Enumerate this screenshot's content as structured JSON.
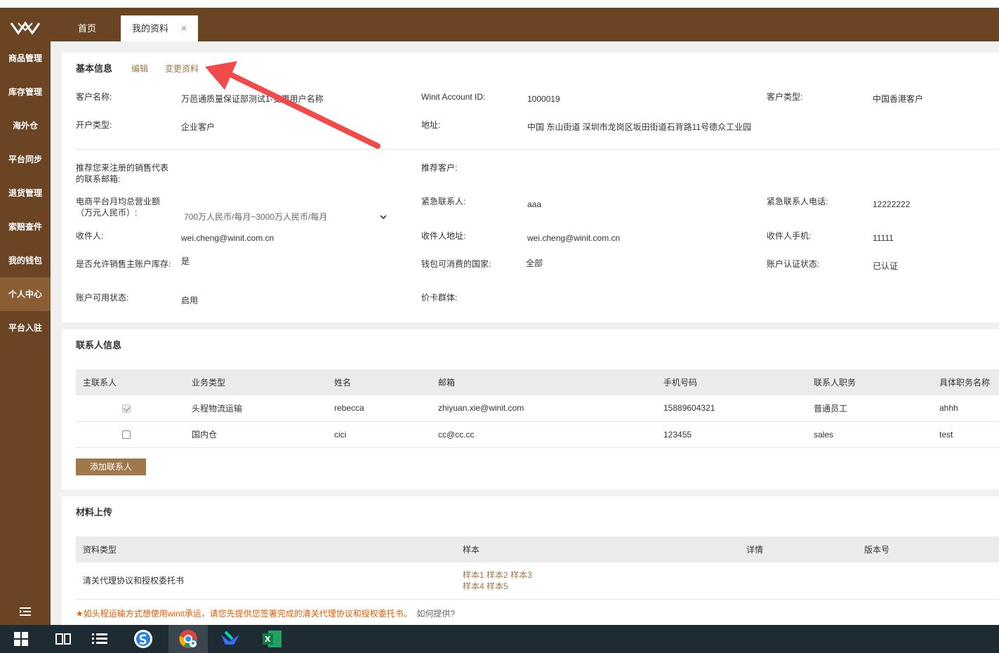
{
  "sidebar": {
    "items": [
      {
        "label": "商品管理"
      },
      {
        "label": "库存管理"
      },
      {
        "label": "海外仓"
      },
      {
        "label": "平台同步"
      },
      {
        "label": "退货管理"
      },
      {
        "label": "索赔查件"
      },
      {
        "label": "我的钱包"
      },
      {
        "label": "个人中心"
      },
      {
        "label": "平台入驻"
      }
    ],
    "active_index": 7
  },
  "tabs": {
    "home": "首页",
    "profile": "我的资料",
    "close": "×"
  },
  "basic": {
    "title": "基本信息",
    "edit": "编辑",
    "change": "变更资料",
    "customer_name_label": "客户名称:",
    "customer_name_value": "万邑通质量保证部测试1-变更用户名称",
    "account_id_label": "Winit Account ID:",
    "account_id_value": "1000019",
    "customer_type_label": "客户类型:",
    "customer_type_value": "中国香港客户",
    "open_type_label": "开户类型:",
    "open_type_value": "企业客户",
    "address_label": "地址:",
    "address_value": "中国 东山街道 深圳市龙岗区坂田街道石背路11号德众工业园",
    "rep_email_label": "推荐您来注册的销售代表的联系邮箱:",
    "rep_email_value": "",
    "referrer_label": "推荐客户:",
    "referrer_value": "",
    "revenue_label": "电商平台月均总营业额（万元人民币）:",
    "revenue_value": "700万人民币/每月~3000万人民币/每月",
    "emergency_contact_label": "紧急联系人:",
    "emergency_contact_value": "aaa",
    "emergency_phone_label": "紧急联系人电话:",
    "emergency_phone_value": "12222222",
    "receiver_label": "收件人:",
    "receiver_value": "wei.cheng@winit.com.cn",
    "receiver_addr_label": "收件人地址:",
    "receiver_addr_value": "wei.cheng@winit.com.cn",
    "receiver_phone_label": "收件人手机:",
    "receiver_phone_value": "11111",
    "allow_sell_label": "是否允许销售主账户库存:",
    "allow_sell_value": "是",
    "wallet_country_label": "钱包可消费的国家:",
    "wallet_country_value": "全部",
    "auth_status_label": "账户认证状态:",
    "auth_status_value": "已认证",
    "available_label": "账户可用状态:",
    "available_value": "启用",
    "price_group_label": "价卡群体:",
    "price_group_value": ""
  },
  "contacts": {
    "title": "联系人信息",
    "headers": [
      "主联系人",
      "业务类型",
      "姓名",
      "邮箱",
      "手机号码",
      "联系人职务",
      "具体职务名称"
    ],
    "rows": [
      {
        "primary": true,
        "biz": "头程物流运输",
        "name": "rebecca",
        "email": "zhiyuan.xie@winit.com",
        "phone": "15889604321",
        "role": "普通员工",
        "title": "ahhh"
      },
      {
        "primary": false,
        "biz": "国内仓",
        "name": "cici",
        "email": "cc@cc.cc",
        "phone": "123455",
        "role": "sales",
        "title": "test"
      }
    ],
    "add_button": "添加联系人"
  },
  "materials": {
    "title": "材料上传",
    "headers": [
      "资料类型",
      "样本",
      "详情",
      "版本号"
    ],
    "row_type": "清关代理协议和授权委托书",
    "samples": [
      "样本1",
      "样本2",
      "样本3",
      "样本4",
      "样本5"
    ],
    "note": "如头程运输方式想使用winit承运，请您先提供您签署完成的清关代理协议和授权委托书。",
    "how": "如何提供?"
  },
  "colors": {
    "sidebar": "#6b4423",
    "accent": "#a0784a",
    "arrow": "#f04a4a"
  }
}
